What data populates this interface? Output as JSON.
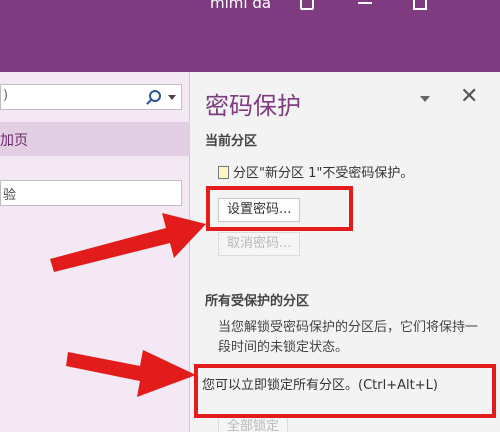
{
  "titlebar": {
    "user": "mimi da"
  },
  "left_pane": {
    "search_text": ")",
    "add_page_label": "加页",
    "page_input_value": "验"
  },
  "right_pane": {
    "title": "密码保护",
    "current_section": {
      "heading": "当前分区",
      "status": "分区\"新分区 1\"不受密码保护。",
      "set_password_label": "设置密码...",
      "remove_password_label": "取消密码..."
    },
    "all_protected": {
      "heading": "所有受保护的分区",
      "description": "当您解锁受密码保护的分区后，它们将保持一段时间的未锁定状态。",
      "lock_all_text": "您可以立即锁定所有分区。(Ctrl+Alt+L)",
      "lock_all_label": "全部锁定"
    }
  },
  "icons": [
    "search-icon",
    "dropdown-caret-icon",
    "close-icon",
    "notebook-section-icon",
    "red-arrow-icon"
  ],
  "colors": {
    "titlebar": "#7f3b7f",
    "pane_title": "#7f3b7f",
    "highlight": "#e21b1b",
    "left_pane": "#f3e8f3"
  }
}
